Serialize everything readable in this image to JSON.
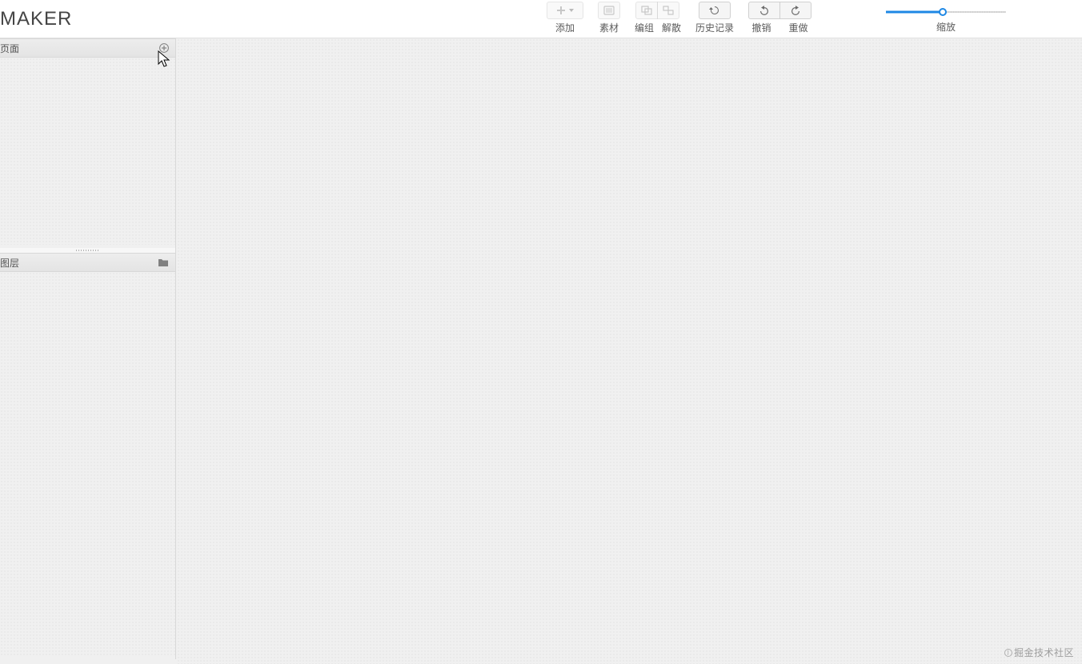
{
  "header": {
    "logo": "MAKER",
    "groups": {
      "add": {
        "label": "添加"
      },
      "material": {
        "label": "素材"
      },
      "group": {
        "label": "编组"
      },
      "ungroup": {
        "label": "解散"
      },
      "history": {
        "label": "历史记录"
      },
      "undo": {
        "label": "撤销"
      },
      "redo": {
        "label": "重做"
      }
    },
    "zoom": {
      "label": "缩放",
      "percent": 47
    }
  },
  "sidebar": {
    "pages": {
      "title": "页面"
    },
    "layers": {
      "title": "图层"
    }
  },
  "watermark": "掘金技术社区"
}
